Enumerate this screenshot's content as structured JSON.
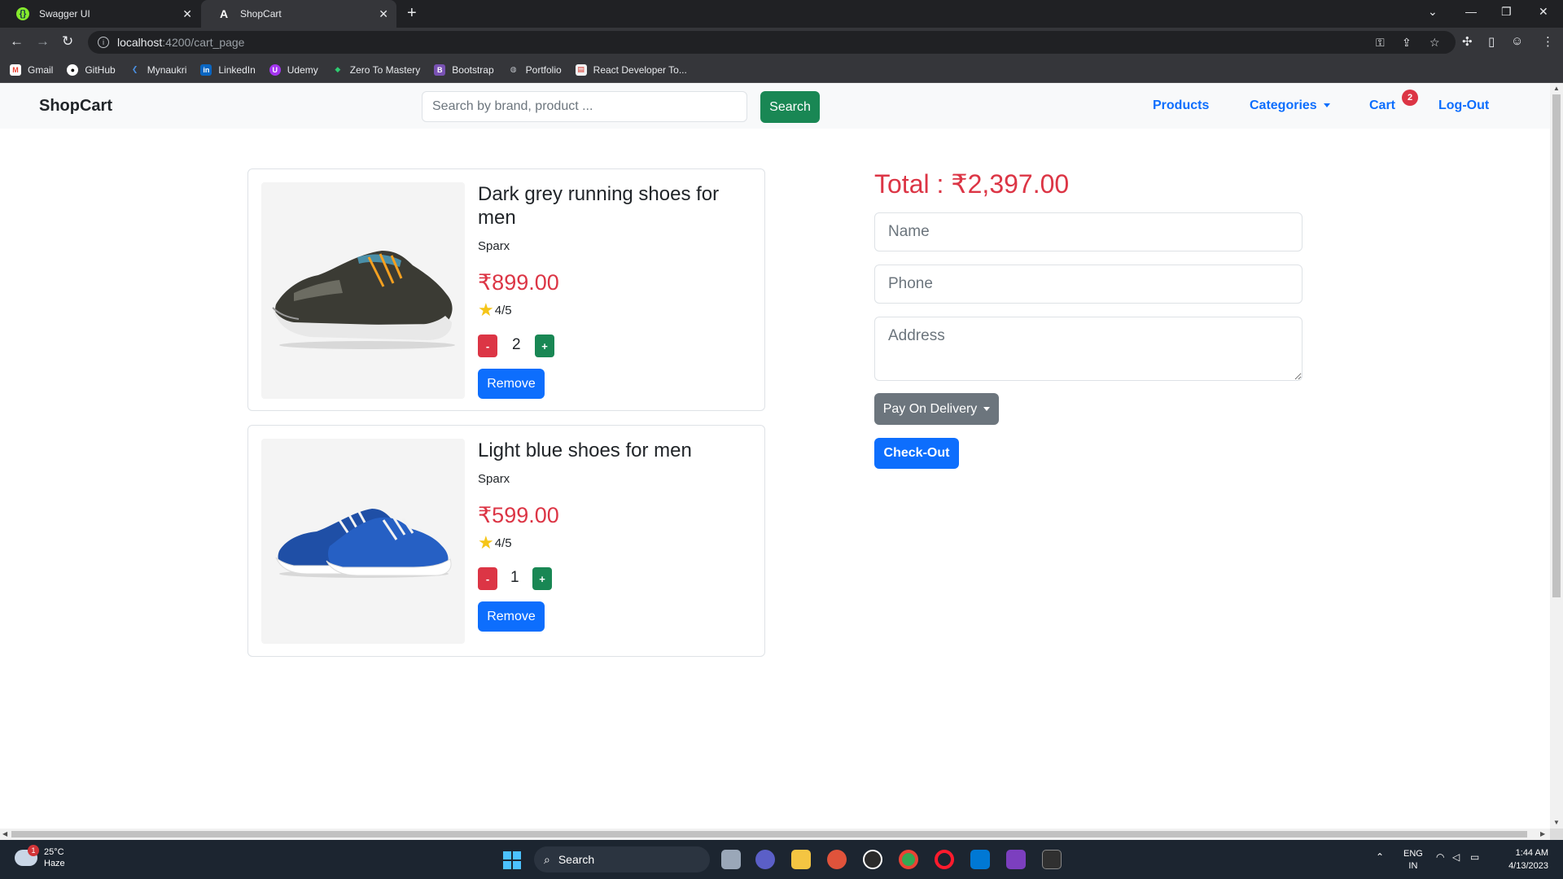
{
  "browser": {
    "tabs": [
      {
        "title": "Swagger UI",
        "active": false
      },
      {
        "title": "ShopCart",
        "active": true
      }
    ],
    "new_tab": "+",
    "url_host": "localhost",
    "url_path": ":4200/cart_page",
    "bookmarks": [
      "Gmail",
      "GitHub",
      "Mynaukri",
      "LinkedIn",
      "Udemy",
      "Zero To Mastery",
      "Bootstrap",
      "Portfolio",
      "React Developer To..."
    ]
  },
  "navbar": {
    "brand": "ShopCart",
    "search_placeholder": "Search by brand, product ...",
    "search_button": "Search",
    "links": {
      "products": "Products",
      "categories": "Categories",
      "cart": "Cart",
      "logout": "Log-Out"
    },
    "cart_count": "2"
  },
  "cart": {
    "items": [
      {
        "title": "Dark grey running shoes for men",
        "brand": "Sparx",
        "price": "₹899.00",
        "rating": "4/5",
        "qty": "2",
        "minus": "-",
        "plus": "+",
        "remove": "Remove"
      },
      {
        "title": "Light blue shoes for men",
        "brand": "Sparx",
        "price": "₹599.00",
        "rating": "4/5",
        "qty": "1",
        "minus": "-",
        "plus": "+",
        "remove": "Remove"
      }
    ]
  },
  "checkout": {
    "total": "Total : ₹2,397.00",
    "name_placeholder": "Name",
    "phone_placeholder": "Phone",
    "address_placeholder": "Address",
    "payment_method": "Pay On Delivery",
    "checkout_button": "Check-Out"
  },
  "taskbar": {
    "weather_temp": "25°C",
    "weather_desc": "Haze",
    "weather_badge": "1",
    "search": "Search",
    "lang_1": "ENG",
    "lang_2": "IN",
    "time": "1:44 AM",
    "date": "4/13/2023"
  },
  "colors": {
    "primary": "#0d6efd",
    "success": "#198754",
    "danger": "#dc3545",
    "secondary": "#6c757d"
  }
}
